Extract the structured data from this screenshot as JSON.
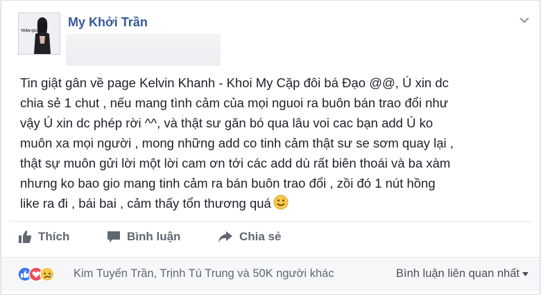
{
  "post": {
    "author": "My Khởi Trần",
    "avatar_icon": "profile-photo",
    "avatar_caption": "TRẦN QUA",
    "body": "Tin giật gân về page Kelvin Khanh - Khoi My Cặp đôi bá Đạo @@, Ú xin dc\nchia sẻ 1 chut , nếu mang tình cảm của mọi nguoi ra buôn bán trao đổi như\nvậy Ú xin dc phép rời ^^, và thật sư găn bó qua lâu voi cac bạn add Ú ko\nmuôn xa mọi người , mong những add co tinh cảm thật sư se sơm quay lại ,\nthật sự muôn gửi lời một lời cam ơn tới các add dù rất biên thoái và ba xàm\nnhưng ko bao gio mang tinh cảm ra bán buôn trao đổi , zồi đó 1 nút hồng\nlike ra đi , bái bai , cảm thấy tổn thương quá",
    "emoji_icon": "smiley-icon"
  },
  "actions": {
    "like": "Thích",
    "comment": "Bình luận",
    "share": "Chia sẻ"
  },
  "reactions": {
    "summary": "Kim Tuyến Trần, Trịnh Tú Trung và 50K người khác",
    "sort_label": "Bình luận liên quan nhất",
    "icons": [
      "like-icon",
      "love-icon",
      "sad-icon"
    ],
    "colors": {
      "like": "#3b77ec",
      "love": "#ee4e5a",
      "sad": "#f7c84a"
    }
  },
  "colors": {
    "author": "#365899",
    "muted": "#606770"
  }
}
